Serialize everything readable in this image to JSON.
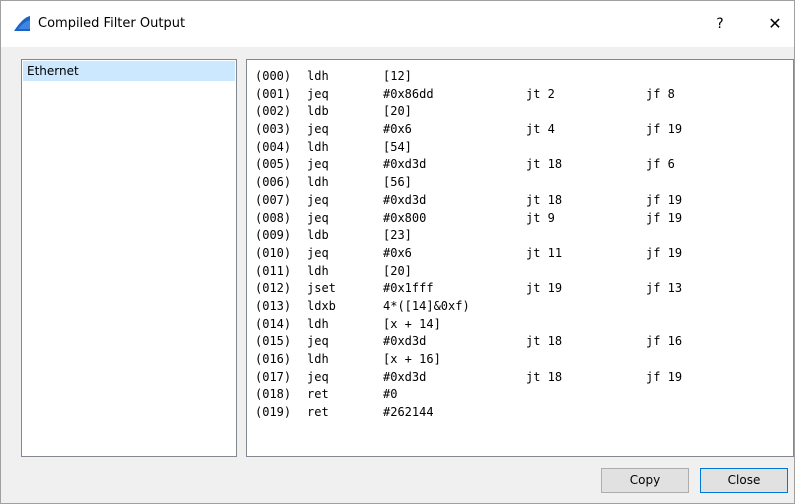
{
  "window": {
    "title": "Compiled Filter Output",
    "help_label": "?",
    "close_label": "✕",
    "accent_color": "#0078d7"
  },
  "interfaces": [
    {
      "label": "Ethernet",
      "selected": true
    }
  ],
  "bpf_code": [
    {
      "idx": "(000)",
      "op": "ldh",
      "arg": "[12]",
      "jt": "",
      "jf": ""
    },
    {
      "idx": "(001)",
      "op": "jeq",
      "arg": "#0x86dd",
      "jt": "jt 2",
      "jf": "jf 8"
    },
    {
      "idx": "(002)",
      "op": "ldb",
      "arg": "[20]",
      "jt": "",
      "jf": ""
    },
    {
      "idx": "(003)",
      "op": "jeq",
      "arg": "#0x6",
      "jt": "jt 4",
      "jf": "jf 19"
    },
    {
      "idx": "(004)",
      "op": "ldh",
      "arg": "[54]",
      "jt": "",
      "jf": ""
    },
    {
      "idx": "(005)",
      "op": "jeq",
      "arg": "#0xd3d",
      "jt": "jt 18",
      "jf": "jf 6"
    },
    {
      "idx": "(006)",
      "op": "ldh",
      "arg": "[56]",
      "jt": "",
      "jf": ""
    },
    {
      "idx": "(007)",
      "op": "jeq",
      "arg": "#0xd3d",
      "jt": "jt 18",
      "jf": "jf 19"
    },
    {
      "idx": "(008)",
      "op": "jeq",
      "arg": "#0x800",
      "jt": "jt 9",
      "jf": "jf 19"
    },
    {
      "idx": "(009)",
      "op": "ldb",
      "arg": "[23]",
      "jt": "",
      "jf": ""
    },
    {
      "idx": "(010)",
      "op": "jeq",
      "arg": "#0x6",
      "jt": "jt 11",
      "jf": "jf 19"
    },
    {
      "idx": "(011)",
      "op": "ldh",
      "arg": "[20]",
      "jt": "",
      "jf": ""
    },
    {
      "idx": "(012)",
      "op": "jset",
      "arg": "#0x1fff",
      "jt": "jt 19",
      "jf": "jf 13"
    },
    {
      "idx": "(013)",
      "op": "ldxb",
      "arg": "4*([14]&0xf)",
      "jt": "",
      "jf": ""
    },
    {
      "idx": "(014)",
      "op": "ldh",
      "arg": "[x + 14]",
      "jt": "",
      "jf": ""
    },
    {
      "idx": "(015)",
      "op": "jeq",
      "arg": "#0xd3d",
      "jt": "jt 18",
      "jf": "jf 16"
    },
    {
      "idx": "(016)",
      "op": "ldh",
      "arg": "[x + 16]",
      "jt": "",
      "jf": ""
    },
    {
      "idx": "(017)",
      "op": "jeq",
      "arg": "#0xd3d",
      "jt": "jt 18",
      "jf": "jf 19"
    },
    {
      "idx": "(018)",
      "op": "ret",
      "arg": "#0",
      "jt": "",
      "jf": ""
    },
    {
      "idx": "(019)",
      "op": "ret",
      "arg": "#262144",
      "jt": "",
      "jf": ""
    }
  ],
  "buttons": {
    "copy_label": "Copy",
    "close_label": "Close"
  }
}
